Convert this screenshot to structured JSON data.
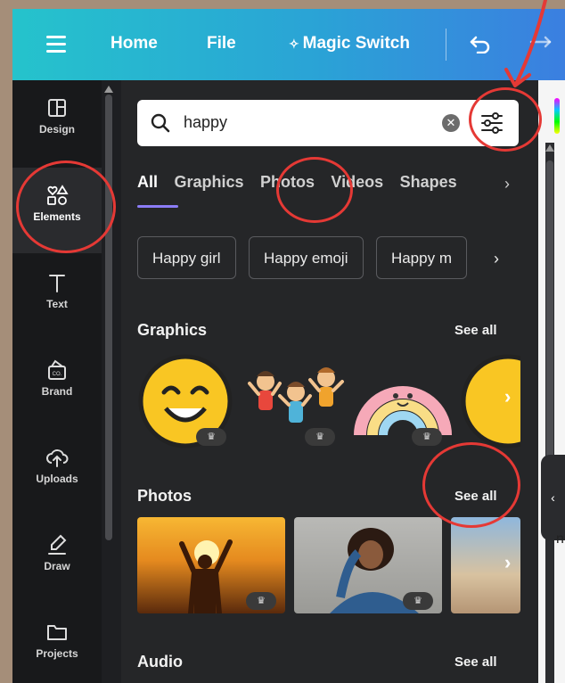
{
  "topbar": {
    "home": "Home",
    "file": "File",
    "magic_switch": "Magic Switch"
  },
  "rail": {
    "items": [
      {
        "label": "Design",
        "icon": "layout-icon"
      },
      {
        "label": "Elements",
        "icon": "shapes-icon"
      },
      {
        "label": "Text",
        "icon": "text-icon"
      },
      {
        "label": "Brand",
        "icon": "brand-kit-icon"
      },
      {
        "label": "Uploads",
        "icon": "cloud-upload-icon"
      },
      {
        "label": "Draw",
        "icon": "draw-icon"
      },
      {
        "label": "Projects",
        "icon": "folder-icon"
      }
    ],
    "active": "Elements"
  },
  "search": {
    "value": "happy"
  },
  "tabs": [
    "All",
    "Graphics",
    "Photos",
    "Videos",
    "Shapes"
  ],
  "active_tab": "All",
  "chips": [
    "Happy girl",
    "Happy emoji",
    "Happy m"
  ],
  "sections": {
    "graphics": {
      "title": "Graphics",
      "see_all": "See all"
    },
    "photos": {
      "title": "Photos",
      "see_all": "See all"
    },
    "audio": {
      "title": "Audio",
      "see_all": "See all"
    }
  },
  "colors": {
    "topbar_start": "#25c3cc",
    "topbar_end": "#3b7fe0",
    "panel_bg": "#252628",
    "accent_underline": "#8b7cf6",
    "annotation_red": "#e53935"
  }
}
